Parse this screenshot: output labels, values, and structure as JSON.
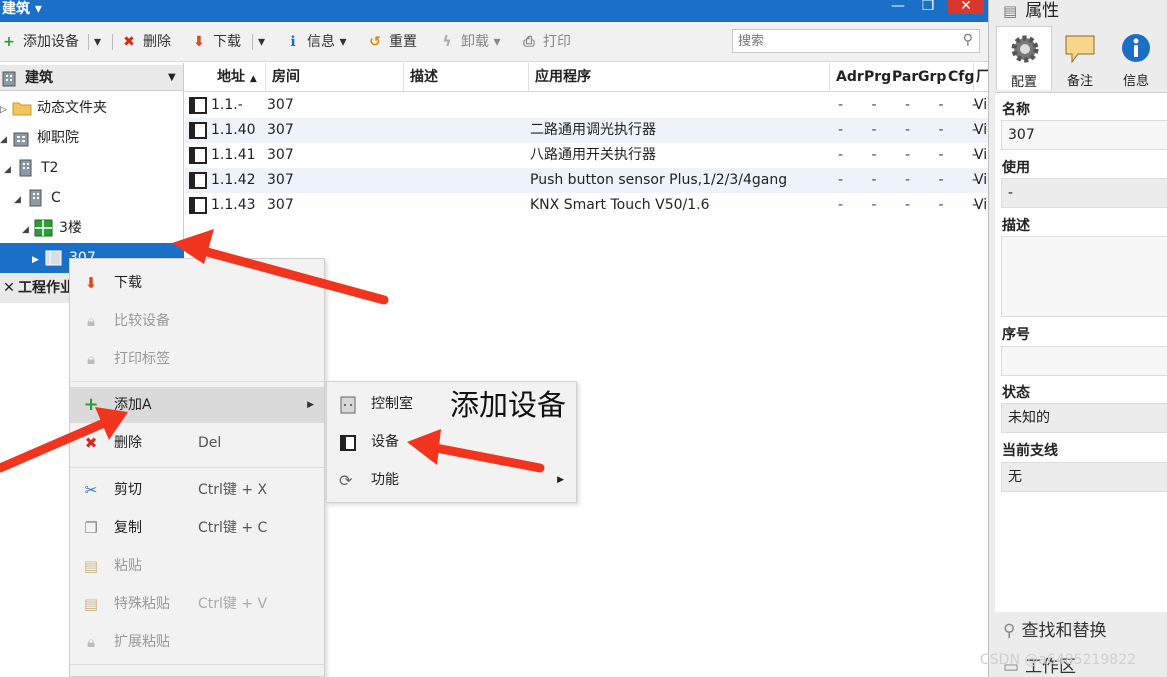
{
  "window": {
    "title": "建筑"
  },
  "toolbar": {
    "add_device": "添加设备",
    "delete": "删除",
    "download": "下载",
    "info": "信息",
    "reset": "重置",
    "unload": "卸载",
    "print": "打印",
    "search_placeholder": "搜索"
  },
  "tree": {
    "header": "建筑",
    "items": [
      {
        "label": "动态文件夹",
        "icon": "folder-icon"
      },
      {
        "label": "柳职院",
        "icon": "building-icon"
      },
      {
        "label": "T2",
        "icon": "building-icon"
      },
      {
        "label": "C",
        "icon": "building-icon"
      },
      {
        "label": "3楼",
        "icon": "floor-icon"
      },
      {
        "label": "307",
        "icon": "room-icon"
      }
    ],
    "footer": "工程作业"
  },
  "table": {
    "columns": [
      "地址",
      "房间",
      "描述",
      "应用程序",
      "Adr",
      "Prg",
      "Par",
      "Grp",
      "Cfg",
      "厂"
    ],
    "rows": [
      {
        "address": "1.1.-",
        "room": "307",
        "description": "",
        "application": "",
        "flags": "- - - - -",
        "mfr": "Vie"
      },
      {
        "address": "1.1.40",
        "room": "307",
        "description": "",
        "application": "二路通用调光执行器",
        "flags": "- - - - -",
        "mfr": "Vie"
      },
      {
        "address": "1.1.41",
        "room": "307",
        "description": "",
        "application": "八路通用开关执行器",
        "flags": "- - - - -",
        "mfr": "Vie"
      },
      {
        "address": "1.1.42",
        "room": "307",
        "description": "",
        "application": "Push button sensor Plus,1/2/3/4gang",
        "flags": "- - - - -",
        "mfr": "Vie"
      },
      {
        "address": "1.1.43",
        "room": "307",
        "description": "",
        "application": "KNX Smart Touch V50/1.6",
        "flags": "- - - - -",
        "mfr": "Vie"
      }
    ]
  },
  "context_menu": {
    "items": [
      {
        "label": "下载",
        "shortcut": ""
      },
      {
        "label": "比较设备",
        "shortcut": ""
      },
      {
        "label": "打印标签",
        "shortcut": ""
      },
      {
        "label": "添加A",
        "shortcut": ""
      },
      {
        "label": "删除",
        "shortcut": "Del"
      },
      {
        "label": "剪切",
        "shortcut": "Ctrl键 + X"
      },
      {
        "label": "复制",
        "shortcut": "Ctrl键 + C"
      },
      {
        "label": "粘贴",
        "shortcut": ""
      },
      {
        "label": "特殊粘贴",
        "shortcut": "Ctrl键 + V"
      },
      {
        "label": "扩展粘贴",
        "shortcut": ""
      }
    ]
  },
  "submenu": {
    "items": [
      {
        "label": "控制室"
      },
      {
        "label": "设备"
      },
      {
        "label": "功能"
      }
    ]
  },
  "annotation": "添加设备",
  "properties": {
    "title": "属性",
    "tabs": [
      "配置",
      "备注",
      "信息"
    ],
    "fields": {
      "name_label": "名称",
      "name_value": "307",
      "usage_label": "使用",
      "usage_value": "-",
      "desc_label": "描述",
      "desc_value": "",
      "seq_label": "序号",
      "seq_value": "",
      "status_label": "状态",
      "status_value": "未知的",
      "line_label": "当前支线",
      "line_value": "无"
    },
    "find_replace": "查找和替换",
    "workspace": "工作区"
  },
  "watermark": "CSDN @a6485219822",
  "colors": {
    "accent": "#1a70c6",
    "arrow": "#f0341e"
  }
}
